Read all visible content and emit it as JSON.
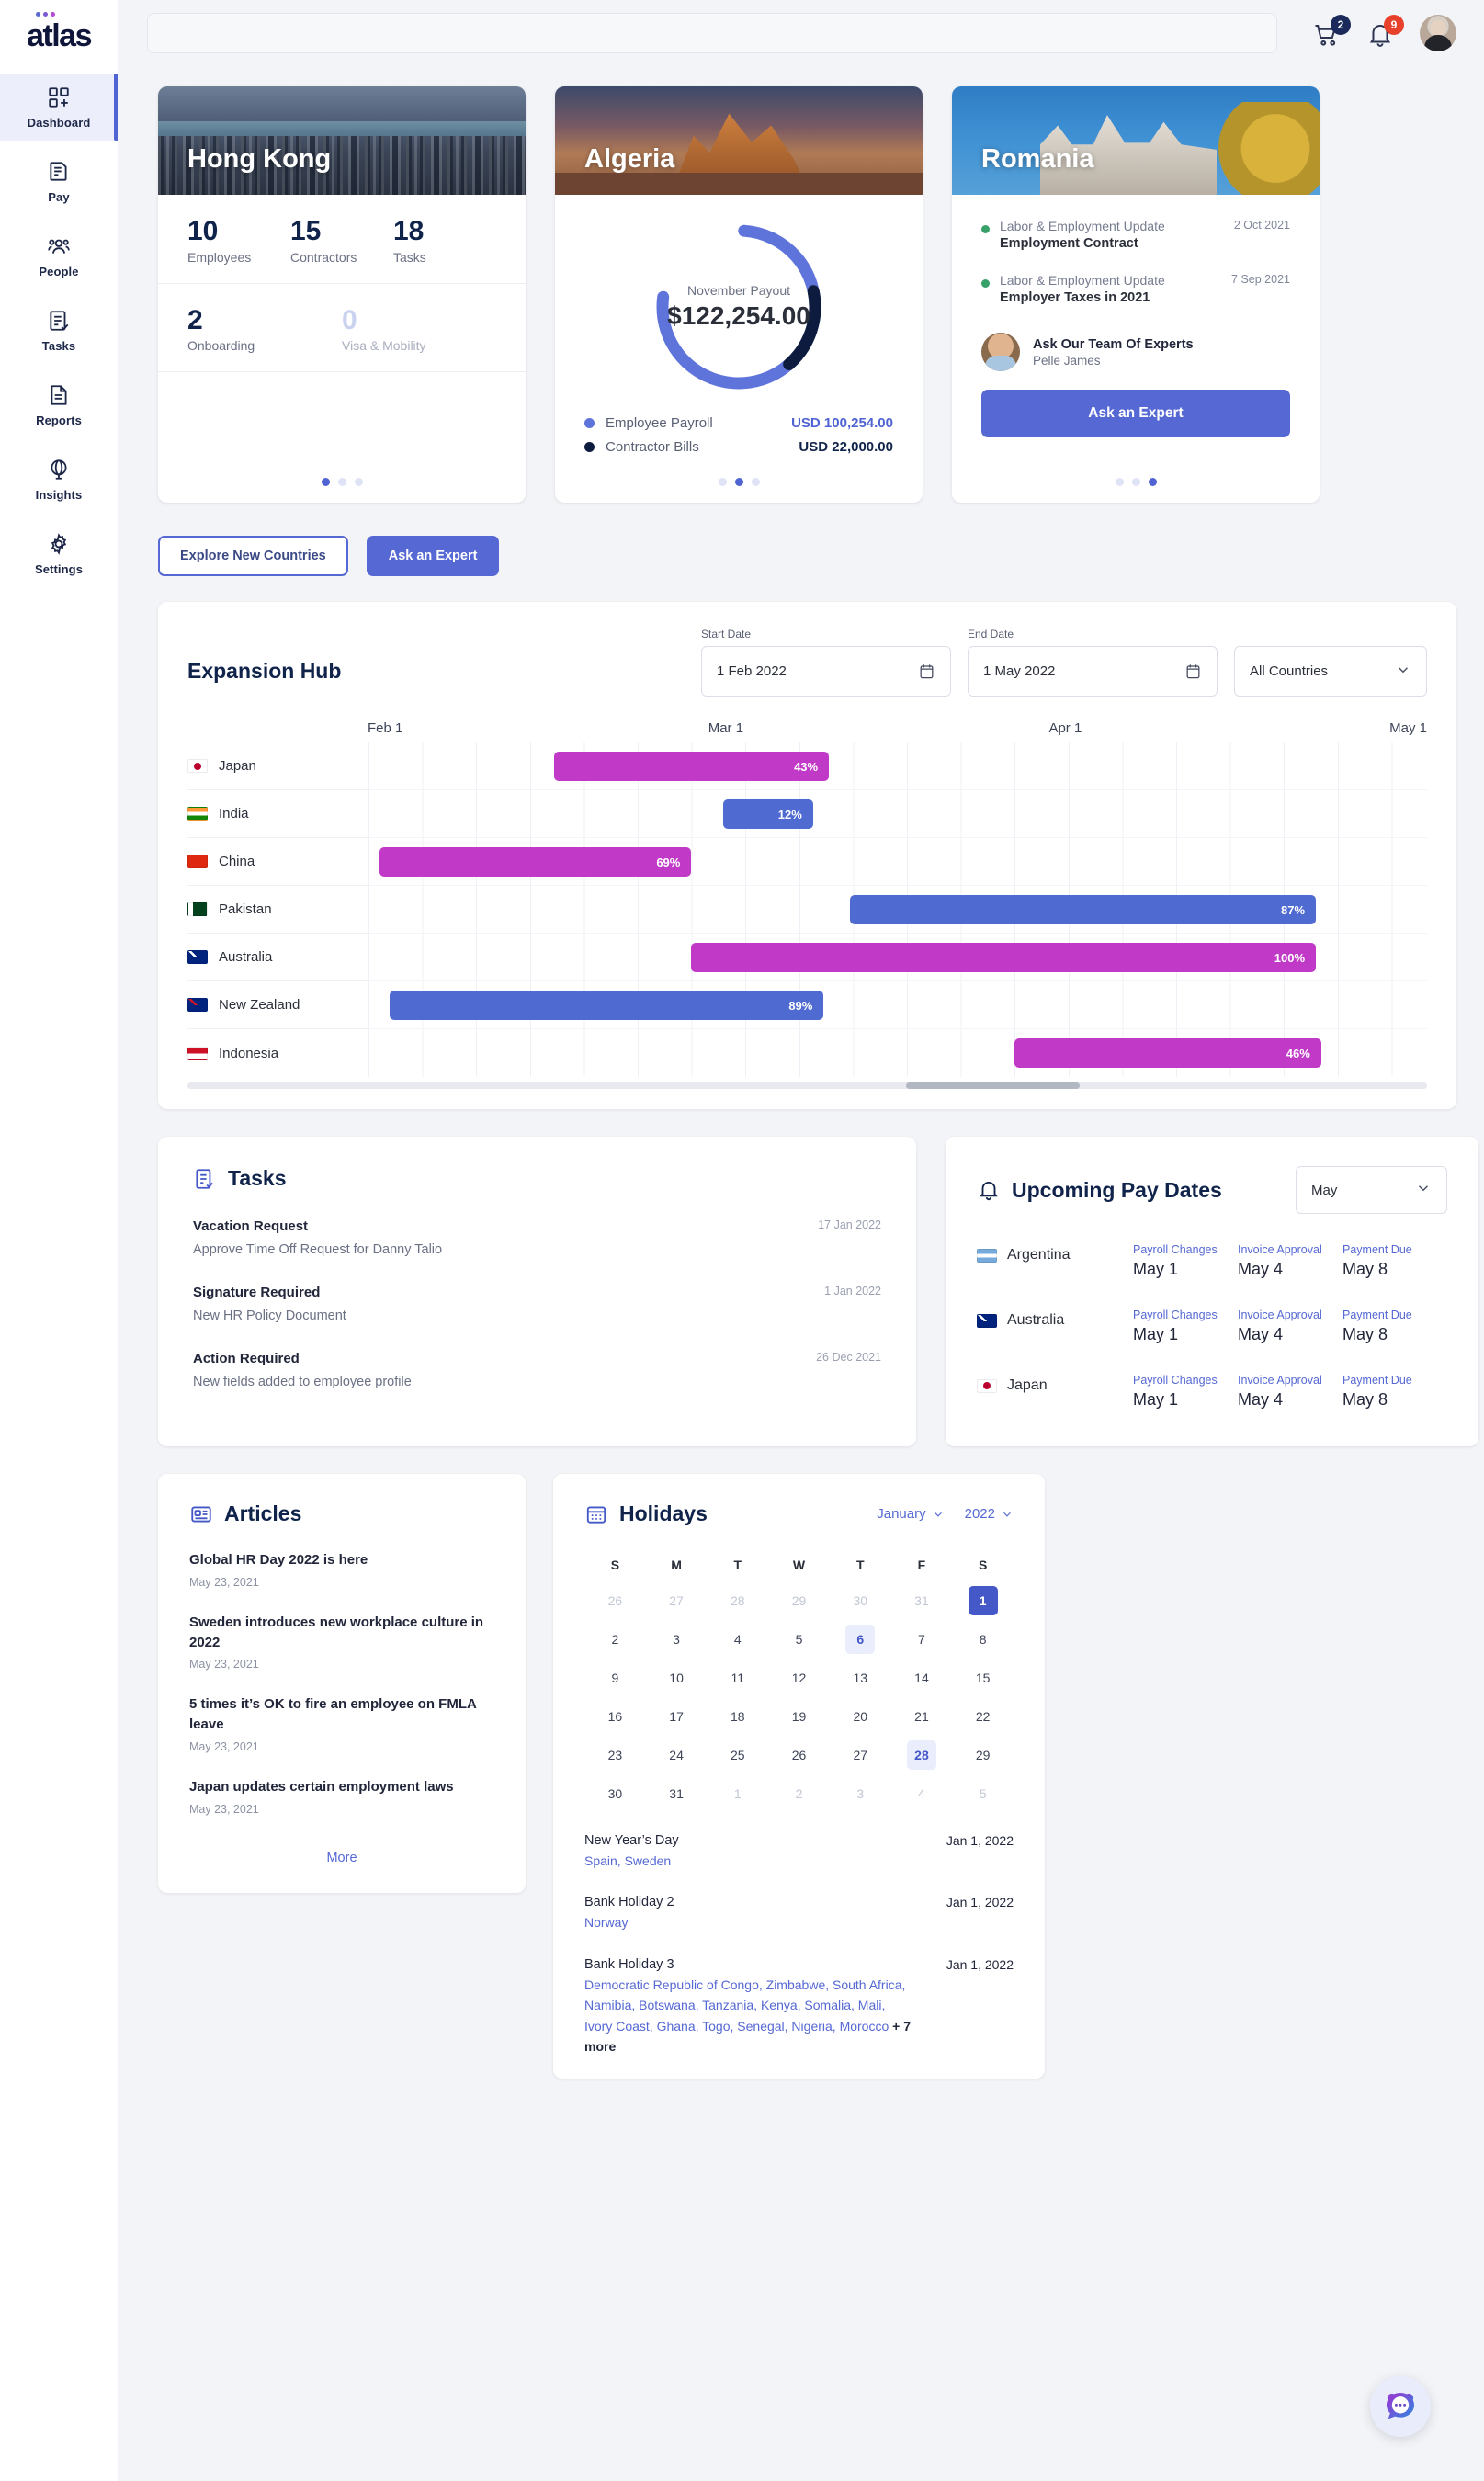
{
  "brand": {
    "name": "atlas"
  },
  "sidebar": {
    "items": [
      {
        "label": "Dashboard",
        "icon": "dashboard-grid-icon",
        "active": true
      },
      {
        "label": "Pay",
        "icon": "pay-document-icon",
        "active": false
      },
      {
        "label": "People",
        "icon": "people-group-icon",
        "active": false
      },
      {
        "label": "Tasks",
        "icon": "tasks-checklist-icon",
        "active": false
      },
      {
        "label": "Reports",
        "icon": "reports-document-icon",
        "active": false
      },
      {
        "label": "Insights",
        "icon": "insights-globe-icon",
        "active": false
      },
      {
        "label": "Settings",
        "icon": "settings-gear-icon",
        "active": false
      }
    ]
  },
  "topbar": {
    "search_placeholder": "",
    "cart_badge": "2",
    "bell_badge": "9"
  },
  "country_cards": [
    {
      "title": "Hong Kong",
      "type": "stats",
      "stats_top": [
        {
          "value": "10",
          "label": "Employees"
        },
        {
          "value": "15",
          "label": "Contractors"
        },
        {
          "value": "18",
          "label": "Tasks"
        }
      ],
      "stats_bottom": [
        {
          "value": "2",
          "label": "Onboarding",
          "muted": false
        },
        {
          "value": "0",
          "label": "Visa & Mobility",
          "muted": true
        }
      ],
      "active_dot": 0
    },
    {
      "title": "Algeria",
      "type": "payout",
      "donut_caption": "November Payout",
      "donut_amount": "$122,254.00",
      "legend": [
        {
          "name": "Employee Payroll",
          "value": "USD 100,254.00",
          "color": "#5f74db"
        },
        {
          "name": "Contractor Bills",
          "value": "USD 22,000.00",
          "color": "#0d1b3e"
        }
      ],
      "active_dot": 1
    },
    {
      "title": "Romania",
      "type": "updates",
      "updates": [
        {
          "category": "Labor & Employment Update",
          "title": "Employment Contract",
          "date": "2 Oct 2021"
        },
        {
          "category": "Labor & Employment Update",
          "title": "Employer Taxes in 2021",
          "date": "7 Sep 2021"
        }
      ],
      "expert": {
        "heading": "Ask Our Team Of Experts",
        "name": "Pelle James"
      },
      "cta": "Ask an Expert",
      "active_dot": 2
    }
  ],
  "actions": {
    "explore": "Explore New Countries",
    "ask": "Ask an Expert"
  },
  "expansion_hub": {
    "title": "Expansion Hub",
    "start_date_label": "Start Date",
    "start_date_value": "1 Feb 2022",
    "end_date_label": "End Date",
    "end_date_value": "1 May 2022",
    "country_filter": "All Countries"
  },
  "chart_data": {
    "type": "bar",
    "title": "Expansion Hub",
    "subtitle": "Country expansion progress Gantt",
    "xlabel": "",
    "ylabel": "",
    "axis_ticks": [
      "Feb 1",
      "Mar 1",
      "Apr 1",
      "May 1"
    ],
    "xlim": [
      "2022-02-01",
      "2022-05-01"
    ],
    "grid": true,
    "legend": "none",
    "categories": [
      "Japan",
      "India",
      "China",
      "Pakistan",
      "Australia",
      "New Zealand",
      "Indonesia"
    ],
    "values": [
      43,
      12,
      69,
      87,
      100,
      89,
      46
    ],
    "bars": [
      {
        "country": "Japan",
        "flag": "jp",
        "value": 43,
        "label": "43%",
        "color": "#c13ac7",
        "start_pct": 17.5,
        "width_pct": 26.0
      },
      {
        "country": "India",
        "flag": "in",
        "value": 12,
        "label": "12%",
        "color": "#4f6ad0",
        "start_pct": 33.5,
        "width_pct": 8.5
      },
      {
        "country": "China",
        "flag": "cn",
        "value": 69,
        "label": "69%",
        "color": "#c13ac7",
        "start_pct": 1.0,
        "width_pct": 29.5
      },
      {
        "country": "Pakistan",
        "flag": "pk",
        "value": 87,
        "label": "87%",
        "color": "#4f6ad0",
        "start_pct": 45.5,
        "width_pct": 44.0
      },
      {
        "country": "Australia",
        "flag": "au",
        "value": 100,
        "label": "100%",
        "color": "#c13ac7",
        "start_pct": 30.5,
        "width_pct": 59.0
      },
      {
        "country": "New Zealand",
        "flag": "nz",
        "value": 89,
        "label": "89%",
        "color": "#4f6ad0",
        "start_pct": 2.0,
        "width_pct": 41.0
      },
      {
        "country": "Indonesia",
        "flag": "id",
        "value": 46,
        "label": "46%",
        "color": "#c13ac7",
        "start_pct": 61.0,
        "width_pct": 29.0
      }
    ]
  },
  "tasks": {
    "title": "Tasks",
    "items": [
      {
        "title": "Vacation Request",
        "desc": "Approve Time Off Request for Danny Talio",
        "date": "17 Jan 2022"
      },
      {
        "title": "Signature Required",
        "desc": "New HR Policy Document",
        "date": "1 Jan 2022"
      },
      {
        "title": "Action Required",
        "desc": "New fields added to employee profile",
        "date": "26 Dec 2021"
      }
    ]
  },
  "pay_dates": {
    "title": "Upcoming Pay Dates",
    "month_filter": "May",
    "columns": [
      "Payroll Changes",
      "Invoice Approval",
      "Payment Due"
    ],
    "rows": [
      {
        "country": "Argentina",
        "flag": "ar",
        "values": [
          "May 1",
          "May 4",
          "May 8"
        ]
      },
      {
        "country": "Australia",
        "flag": "au",
        "values": [
          "May 1",
          "May 4",
          "May 8"
        ]
      },
      {
        "country": "Japan",
        "flag": "jp",
        "values": [
          "May 1",
          "May 4",
          "May 8"
        ]
      }
    ]
  },
  "articles": {
    "title": "Articles",
    "items": [
      {
        "headline": "Global HR Day 2022 is here",
        "date": "May 23, 2021"
      },
      {
        "headline": "Sweden introduces new workplace culture in 2022",
        "date": "May 23, 2021"
      },
      {
        "headline": "5 times it’s OK to fire an employee on FMLA leave",
        "date": "May 23, 2021"
      },
      {
        "headline": "Japan updates certain employment laws",
        "date": "May 23, 2021"
      }
    ],
    "more": "More"
  },
  "holidays": {
    "title": "Holidays",
    "month": "January",
    "year": "2022",
    "weekdays": [
      "S",
      "M",
      "T",
      "W",
      "T",
      "F",
      "S"
    ],
    "weeks": [
      [
        {
          "d": "26",
          "s": "out"
        },
        {
          "d": "27",
          "s": "out"
        },
        {
          "d": "28",
          "s": "out"
        },
        {
          "d": "29",
          "s": "out"
        },
        {
          "d": "30",
          "s": "out"
        },
        {
          "d": "31",
          "s": "out"
        },
        {
          "d": "1",
          "s": "sel"
        }
      ],
      [
        {
          "d": "2",
          "s": ""
        },
        {
          "d": "3",
          "s": ""
        },
        {
          "d": "4",
          "s": ""
        },
        {
          "d": "5",
          "s": ""
        },
        {
          "d": "6",
          "s": "hl"
        },
        {
          "d": "7",
          "s": ""
        },
        {
          "d": "8",
          "s": ""
        }
      ],
      [
        {
          "d": "9",
          "s": ""
        },
        {
          "d": "10",
          "s": ""
        },
        {
          "d": "11",
          "s": ""
        },
        {
          "d": "12",
          "s": ""
        },
        {
          "d": "13",
          "s": ""
        },
        {
          "d": "14",
          "s": ""
        },
        {
          "d": "15",
          "s": ""
        }
      ],
      [
        {
          "d": "16",
          "s": ""
        },
        {
          "d": "17",
          "s": ""
        },
        {
          "d": "18",
          "s": ""
        },
        {
          "d": "19",
          "s": ""
        },
        {
          "d": "20",
          "s": ""
        },
        {
          "d": "21",
          "s": ""
        },
        {
          "d": "22",
          "s": ""
        }
      ],
      [
        {
          "d": "23",
          "s": ""
        },
        {
          "d": "24",
          "s": ""
        },
        {
          "d": "25",
          "s": ""
        },
        {
          "d": "26",
          "s": ""
        },
        {
          "d": "27",
          "s": ""
        },
        {
          "d": "28",
          "s": "hl"
        },
        {
          "d": "29",
          "s": ""
        }
      ],
      [
        {
          "d": "30",
          "s": ""
        },
        {
          "d": "31",
          "s": ""
        },
        {
          "d": "1",
          "s": "out"
        },
        {
          "d": "2",
          "s": "out"
        },
        {
          "d": "3",
          "s": "out"
        },
        {
          "d": "4",
          "s": "out"
        },
        {
          "d": "5",
          "s": "out"
        }
      ]
    ],
    "list": [
      {
        "name": "New Year’s Day",
        "date": "Jan 1, 2022",
        "countries": "Spain, Sweden",
        "more": ""
      },
      {
        "name": "Bank Holiday 2",
        "date": "Jan 1, 2022",
        "countries": "Norway",
        "more": ""
      },
      {
        "name": "Bank Holiday 3",
        "date": "Jan 1, 2022",
        "countries": "Democratic Republic of Congo, Zimbabwe, South Africa, Namibia, Botswana, Tanzania, Kenya, Somalia, Mali, Ivory Coast, Ghana, Togo, Senegal, Nigeria, Morocco",
        "more": "+ 7 more"
      }
    ]
  },
  "chat": {
    "label": "chat-bot-launcher"
  }
}
